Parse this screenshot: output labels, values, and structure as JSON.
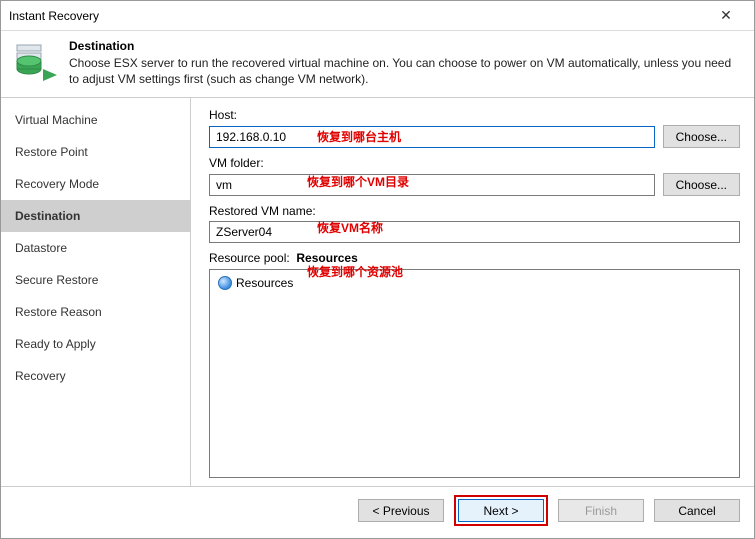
{
  "window": {
    "title": "Instant Recovery"
  },
  "header": {
    "title": "Destination",
    "desc": "Choose ESX server to run the recovered virtual machine on. You can choose to power on VM automatically, unless you need to adjust VM settings first (such as change VM network)."
  },
  "sidebar": {
    "items": [
      {
        "label": "Virtual Machine"
      },
      {
        "label": "Restore Point"
      },
      {
        "label": "Recovery Mode"
      },
      {
        "label": "Destination"
      },
      {
        "label": "Datastore"
      },
      {
        "label": "Secure Restore"
      },
      {
        "label": "Restore Reason"
      },
      {
        "label": "Ready to Apply"
      },
      {
        "label": "Recovery"
      }
    ]
  },
  "main": {
    "host_label": "Host:",
    "host_value": "192.168.0.10",
    "choose_label": "Choose...",
    "vmfolder_label": "VM folder:",
    "vmfolder_value": "vm",
    "restored_label": "Restored VM name:",
    "restored_value": "ZServer04",
    "respool_label": "Resource pool:",
    "respool_value": "Resources",
    "tree_root": "Resources"
  },
  "annotations": {
    "a1": "恢复到哪台主机",
    "a2": "恢复到哪个VM目录",
    "a3": "恢复VM名称",
    "a4": "恢复到哪个资源池"
  },
  "footer": {
    "prev": "< Previous",
    "next": "Next >",
    "finish": "Finish",
    "cancel": "Cancel"
  }
}
